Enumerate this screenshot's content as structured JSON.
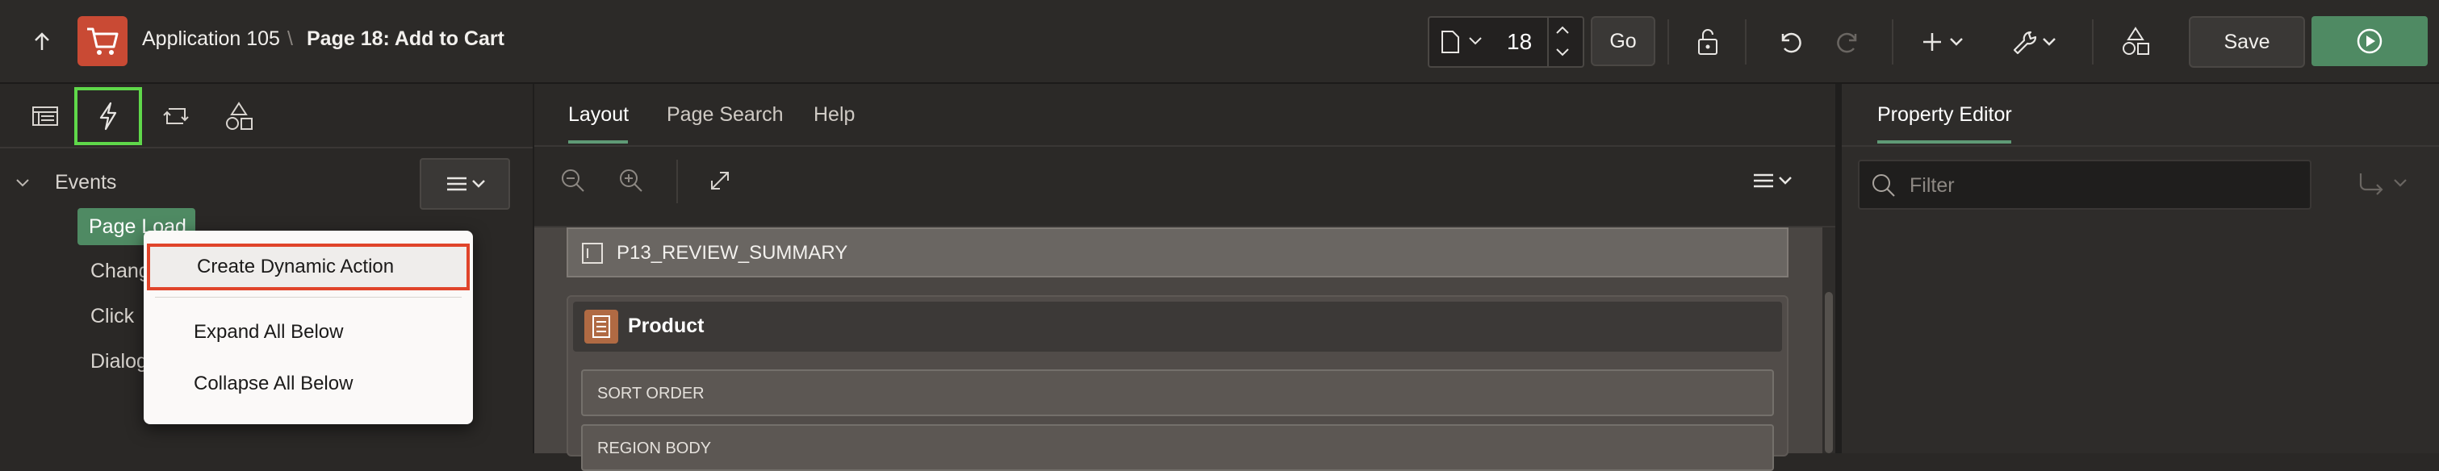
{
  "header": {
    "app_name": "Application 105",
    "separator": "\\",
    "page_title": "Page 18: Add to Cart",
    "page_number": "18",
    "go_label": "Go",
    "save_label": "Save"
  },
  "left_panel": {
    "tree_root": "Events",
    "tree_items": [
      "Page Load",
      "Chang",
      "Click",
      "Dialog"
    ]
  },
  "context_menu": {
    "items": [
      "Create Dynamic Action",
      "Expand All Below",
      "Collapse All Below"
    ]
  },
  "center": {
    "tabs": [
      "Layout",
      "Page Search",
      "Help"
    ],
    "active_tab": "Layout",
    "item_label": "P13_REVIEW_SUMMARY",
    "region_title": "Product",
    "rows": [
      "SORT ORDER",
      "REGION BODY"
    ]
  },
  "right": {
    "tab": "Property Editor",
    "filter_placeholder": "Filter"
  },
  "colors": {
    "accent_green": "#4f8a63",
    "highlight_green": "#5fd84a",
    "menu_highlight_red": "#e0442a",
    "app_icon_red": "#c94a34"
  }
}
